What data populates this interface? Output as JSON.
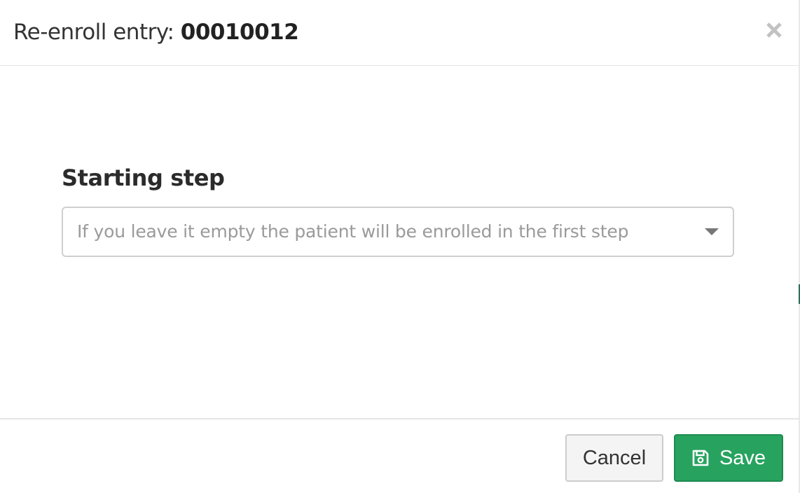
{
  "dialog": {
    "title_prefix": "Re-enroll entry: ",
    "entry_id": "00010012",
    "close_label": "x"
  },
  "form": {
    "starting_step_label": "Starting step",
    "starting_step_placeholder": "If you leave it empty the patient will be enrolled in the first step",
    "starting_step_value": ""
  },
  "footer": {
    "cancel_label": "Cancel",
    "save_label": "Save",
    "save_icon": "floppy-disk-icon"
  },
  "colors": {
    "save_button": "#27a35f",
    "placeholder_text": "#9a9a9a",
    "title_text": "#333333"
  }
}
